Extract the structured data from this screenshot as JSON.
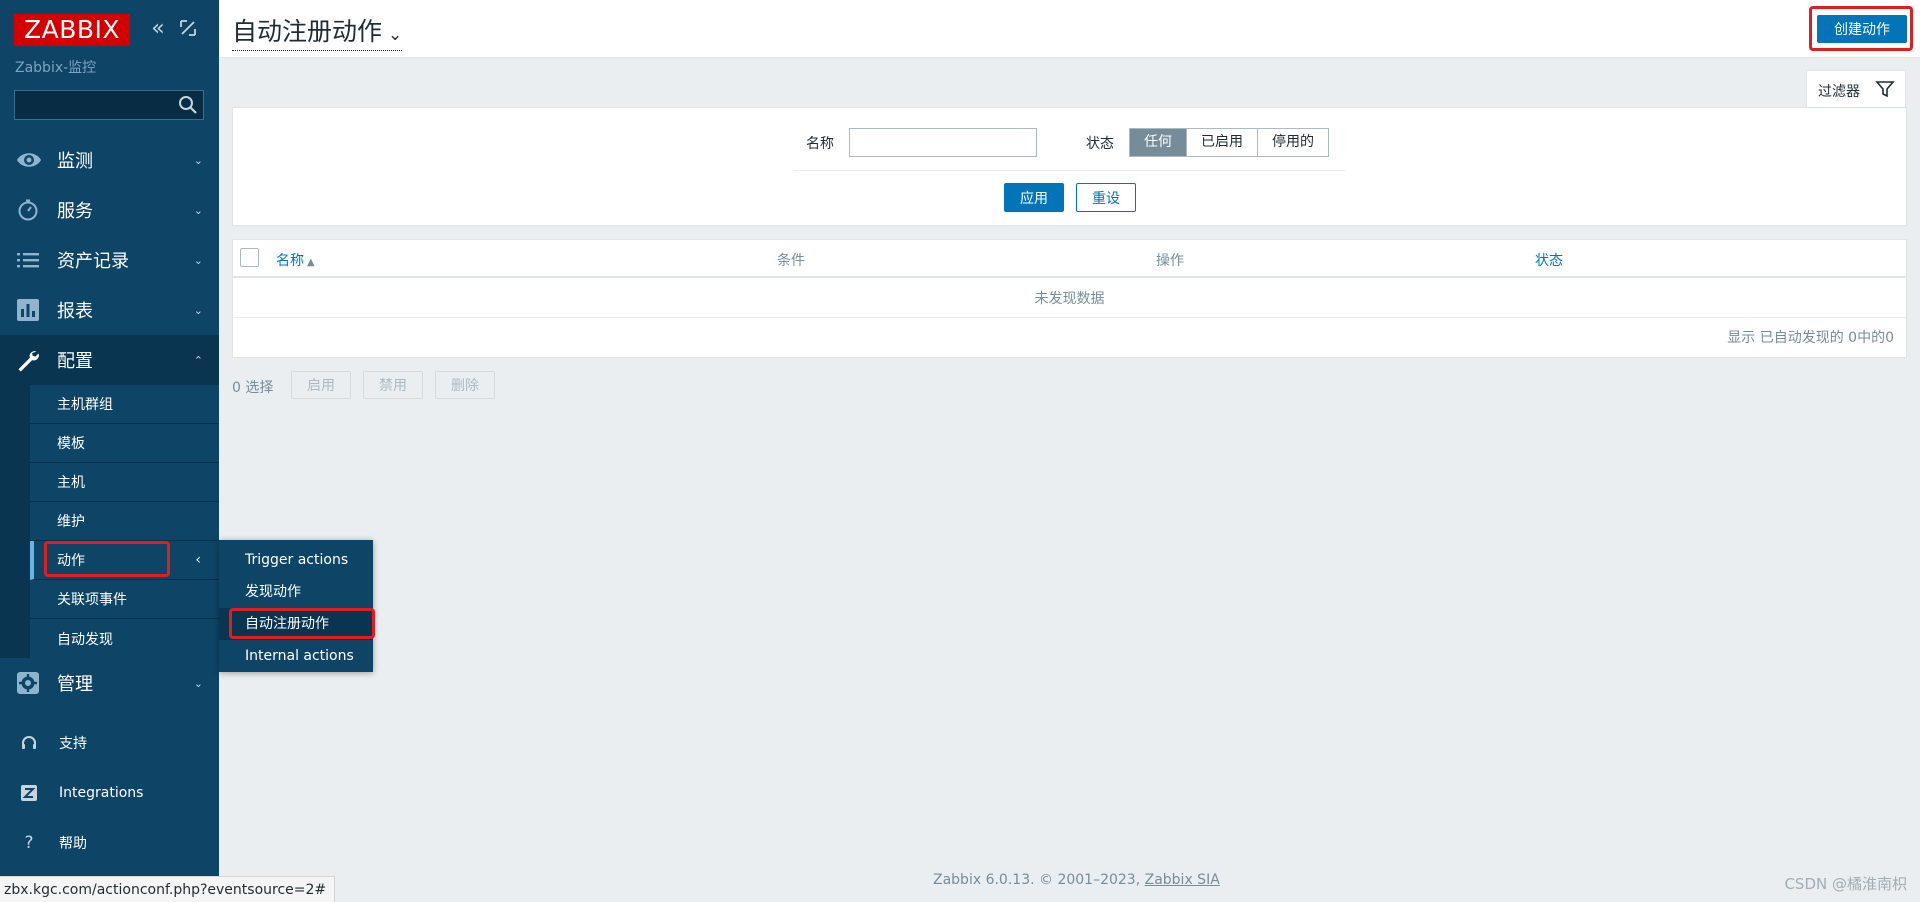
{
  "sidebar": {
    "logo": "ZABBIX",
    "server_name": "Zabbix-监控",
    "search": {
      "value": "",
      "placeholder": ""
    },
    "menu": [
      {
        "id": "monitoring",
        "label": "监测",
        "icon": "eye-icon"
      },
      {
        "id": "services",
        "label": "服务",
        "icon": "stopwatch-icon"
      },
      {
        "id": "inventory",
        "label": "资产记录",
        "icon": "list-icon"
      },
      {
        "id": "reports",
        "label": "报表",
        "icon": "bar-chart-icon"
      },
      {
        "id": "configuration",
        "label": "配置",
        "icon": "wrench-icon"
      }
    ],
    "config_submenu": [
      {
        "label": "主机群组"
      },
      {
        "label": "模板"
      },
      {
        "label": "主机"
      },
      {
        "label": "维护"
      },
      {
        "label": "动作"
      },
      {
        "label": "关联项事件"
      },
      {
        "label": "自动发现"
      }
    ],
    "admin": {
      "label": "管理",
      "icon": "gear-icon"
    },
    "bottom": [
      {
        "label": "支持",
        "icon": "headset-icon"
      },
      {
        "label": "Integrations",
        "icon": "zabbix-z-icon"
      },
      {
        "label": "帮助",
        "icon": "question-icon"
      }
    ]
  },
  "flyout": {
    "items": [
      {
        "label": "Trigger actions"
      },
      {
        "label": "发现动作"
      },
      {
        "label": "自动注册动作"
      },
      {
        "label": "Internal actions"
      }
    ]
  },
  "header": {
    "title": "自动注册动作",
    "create_button": "创建动作"
  },
  "filter": {
    "tab_label": "过滤器",
    "name_label": "名称",
    "name_value": "",
    "status_label": "状态",
    "status_options": [
      "任何",
      "已启用",
      "停用的"
    ],
    "status_selected": "任何",
    "apply_label": "应用",
    "reset_label": "重设"
  },
  "table": {
    "columns": [
      {
        "label": "名称",
        "sortable": true,
        "sort": "asc"
      },
      {
        "label": "条件",
        "sortable": false
      },
      {
        "label": "操作",
        "sortable": false
      },
      {
        "label": "状态",
        "sortable": true
      }
    ],
    "sort_arrow": "▲",
    "rows": [],
    "empty_text": "未发现数据",
    "footer_text": "显示 已自动发现的 0中的0"
  },
  "actions_bar": {
    "selected_count": "0 选择",
    "buttons": [
      "启用",
      "禁用",
      "删除"
    ]
  },
  "footer": {
    "copyright": "Zabbix 6.0.13. © 2001–2023,",
    "company": "Zabbix SIA"
  },
  "watermark": "CSDN @橘淮南枳",
  "status_bar_url": "zbx.kgc.com/actionconf.php?eventsource=2#",
  "colors": {
    "sidebar": "#0e4466",
    "primary": "#0275b8",
    "logo": "#d40000",
    "highlight": "#e01e1e"
  }
}
